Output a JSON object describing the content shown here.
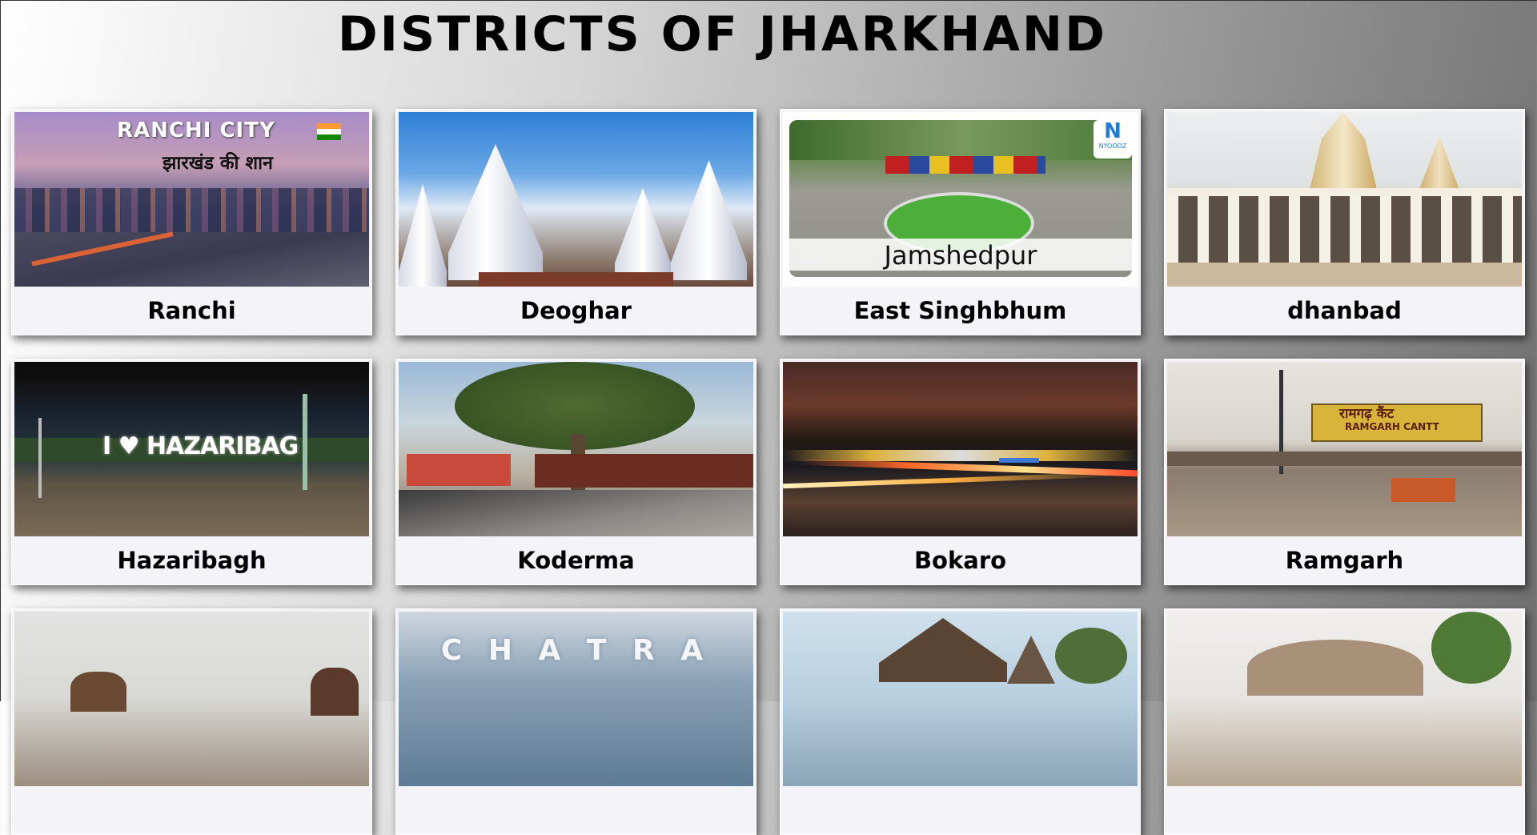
{
  "page": {
    "title": "DISTRICTS OF JHARKHAND"
  },
  "cards": [
    {
      "label": "Ranchi",
      "overlay1": "RANCHI CITY",
      "overlay2": "झारखंड की शान"
    },
    {
      "label": "Deoghar"
    },
    {
      "label": "East Singhbhum",
      "overlay1": "Jamshedpur",
      "badge": "NYOOOZ"
    },
    {
      "label": "dhanbad"
    },
    {
      "label": "Hazaribagh",
      "overlay1": "I ♥ HAZARIBAG"
    },
    {
      "label": "Koderma"
    },
    {
      "label": "Bokaro"
    },
    {
      "label": "Ramgarh",
      "overlay1": "रामगढ़ कैंट",
      "overlay2": "RAMGARH CANTT"
    },
    {
      "label": ""
    },
    {
      "label": "",
      "overlay1": "C H A T R A"
    },
    {
      "label": ""
    },
    {
      "label": ""
    }
  ]
}
